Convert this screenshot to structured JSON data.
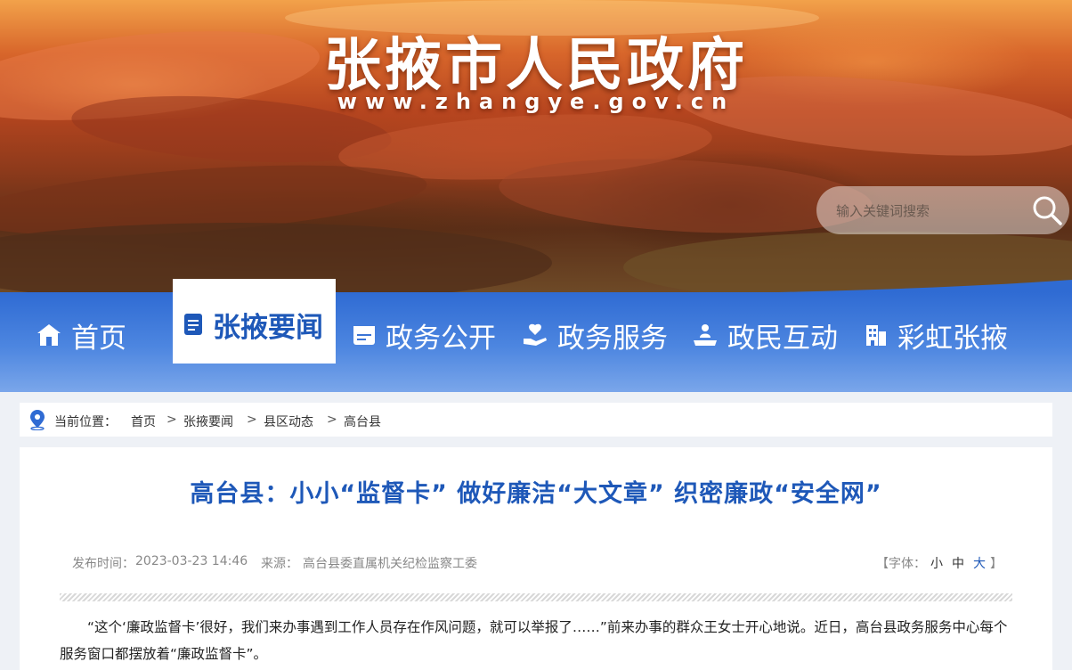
{
  "header": {
    "site_title": "张掖市人民政府",
    "site_url": "www.zhangye.gov.cn",
    "search_placeholder": "输入关键词搜索"
  },
  "nav": {
    "items": [
      {
        "label": "首页",
        "icon": "home-icon"
      },
      {
        "label": "张掖要闻",
        "icon": "news-icon",
        "active": true
      },
      {
        "label": "政务公开",
        "icon": "open-government-icon"
      },
      {
        "label": "政务服务",
        "icon": "service-hand-icon"
      },
      {
        "label": "政民互动",
        "icon": "interaction-icon"
      },
      {
        "label": "彩虹张掖",
        "icon": "building-icon"
      }
    ]
  },
  "breadcrumb": {
    "label": "当前位置：",
    "items": [
      "首页",
      "张掖要闻",
      "县区动态",
      "高台县"
    ],
    "separator": ">"
  },
  "article": {
    "title": "高台县：小小“监督卡” 做好廉洁“大文章” 织密廉政“安全网”",
    "publish_label": "发布时间：",
    "publish_time": "2023-03-23 14:46",
    "source_label": "来源：",
    "source": "高台县委直属机关纪检监察工委",
    "font_size": {
      "open": "【字体：",
      "small": "小",
      "medium": "中",
      "large": "大",
      "close": "】",
      "selected": "large"
    },
    "paragraph": "“这个‘廉政监督卡’很好，我们来办事遇到工作人员存在作风问题，就可以举报了……”前来办事的群众王女士开心地说。近日，高台县政务服务中心每个服务窗口都摆放着“廉政监督卡”。"
  },
  "colors": {
    "nav_blue": "#2f6bd3",
    "title_blue": "#1e58b8",
    "banner_red": "#b5451f"
  }
}
